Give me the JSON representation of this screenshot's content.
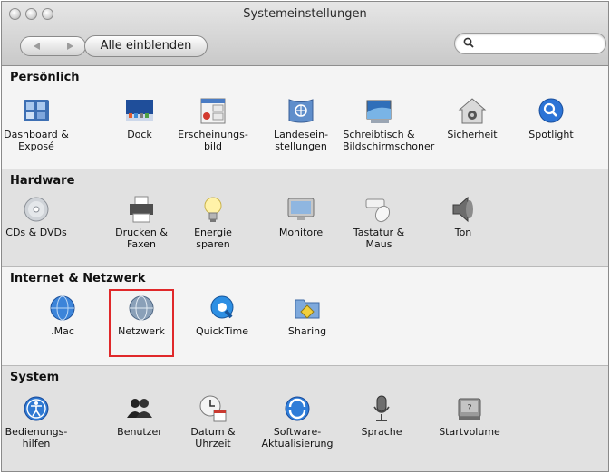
{
  "window": {
    "title": "Systemeinstellungen"
  },
  "toolbar": {
    "show_all_label": "Alle einblenden",
    "search_placeholder": ""
  },
  "sections": [
    {
      "title": "Persönlich",
      "items": [
        "Dashboard &\nExposé",
        "Dock",
        "Erscheinungs-\nbild",
        "Landesein-\nstellungen",
        "Schreibtisch &\nBildschirmschoner",
        "Sicherheit",
        "Spotlight"
      ]
    },
    {
      "title": "Hardware",
      "items": [
        "CDs & DVDs",
        "Drucken &\nFaxen",
        "Energie\nsparen",
        "Monitore",
        "Tastatur &\nMaus",
        "Ton"
      ]
    },
    {
      "title": "Internet & Netzwerk",
      "items": [
        ".Mac",
        "Netzwerk",
        "QuickTime",
        "Sharing"
      ]
    },
    {
      "title": "System",
      "items": [
        "Bedienungs-\nhilfen",
        "Benutzer",
        "Datum &\nUhrzeit",
        "Software-\nAktualisierung",
        "Sprache",
        "Startvolume"
      ]
    }
  ],
  "highlighted_item": "Netzwerk",
  "colors": {
    "highlight": "#e0282a",
    "spotlight_blue": "#2c74d6"
  },
  "icons": {
    "persoenlich": [
      "dashboard-icon",
      "dock-icon",
      "appearance-icon",
      "international-icon",
      "desktop-screensaver-icon",
      "security-icon",
      "spotlight-icon"
    ],
    "hardware": [
      "cd-dvd-icon",
      "printer-icon",
      "lightbulb-icon",
      "monitor-icon",
      "keyboard-mouse-icon",
      "speaker-icon"
    ],
    "internet": [
      "dotmac-globe-icon",
      "network-globe-icon",
      "quicktime-icon",
      "sharing-folder-icon"
    ],
    "system": [
      "accessibility-icon",
      "users-icon",
      "date-time-icon",
      "software-update-icon",
      "microphone-icon",
      "startup-disk-icon"
    ]
  }
}
